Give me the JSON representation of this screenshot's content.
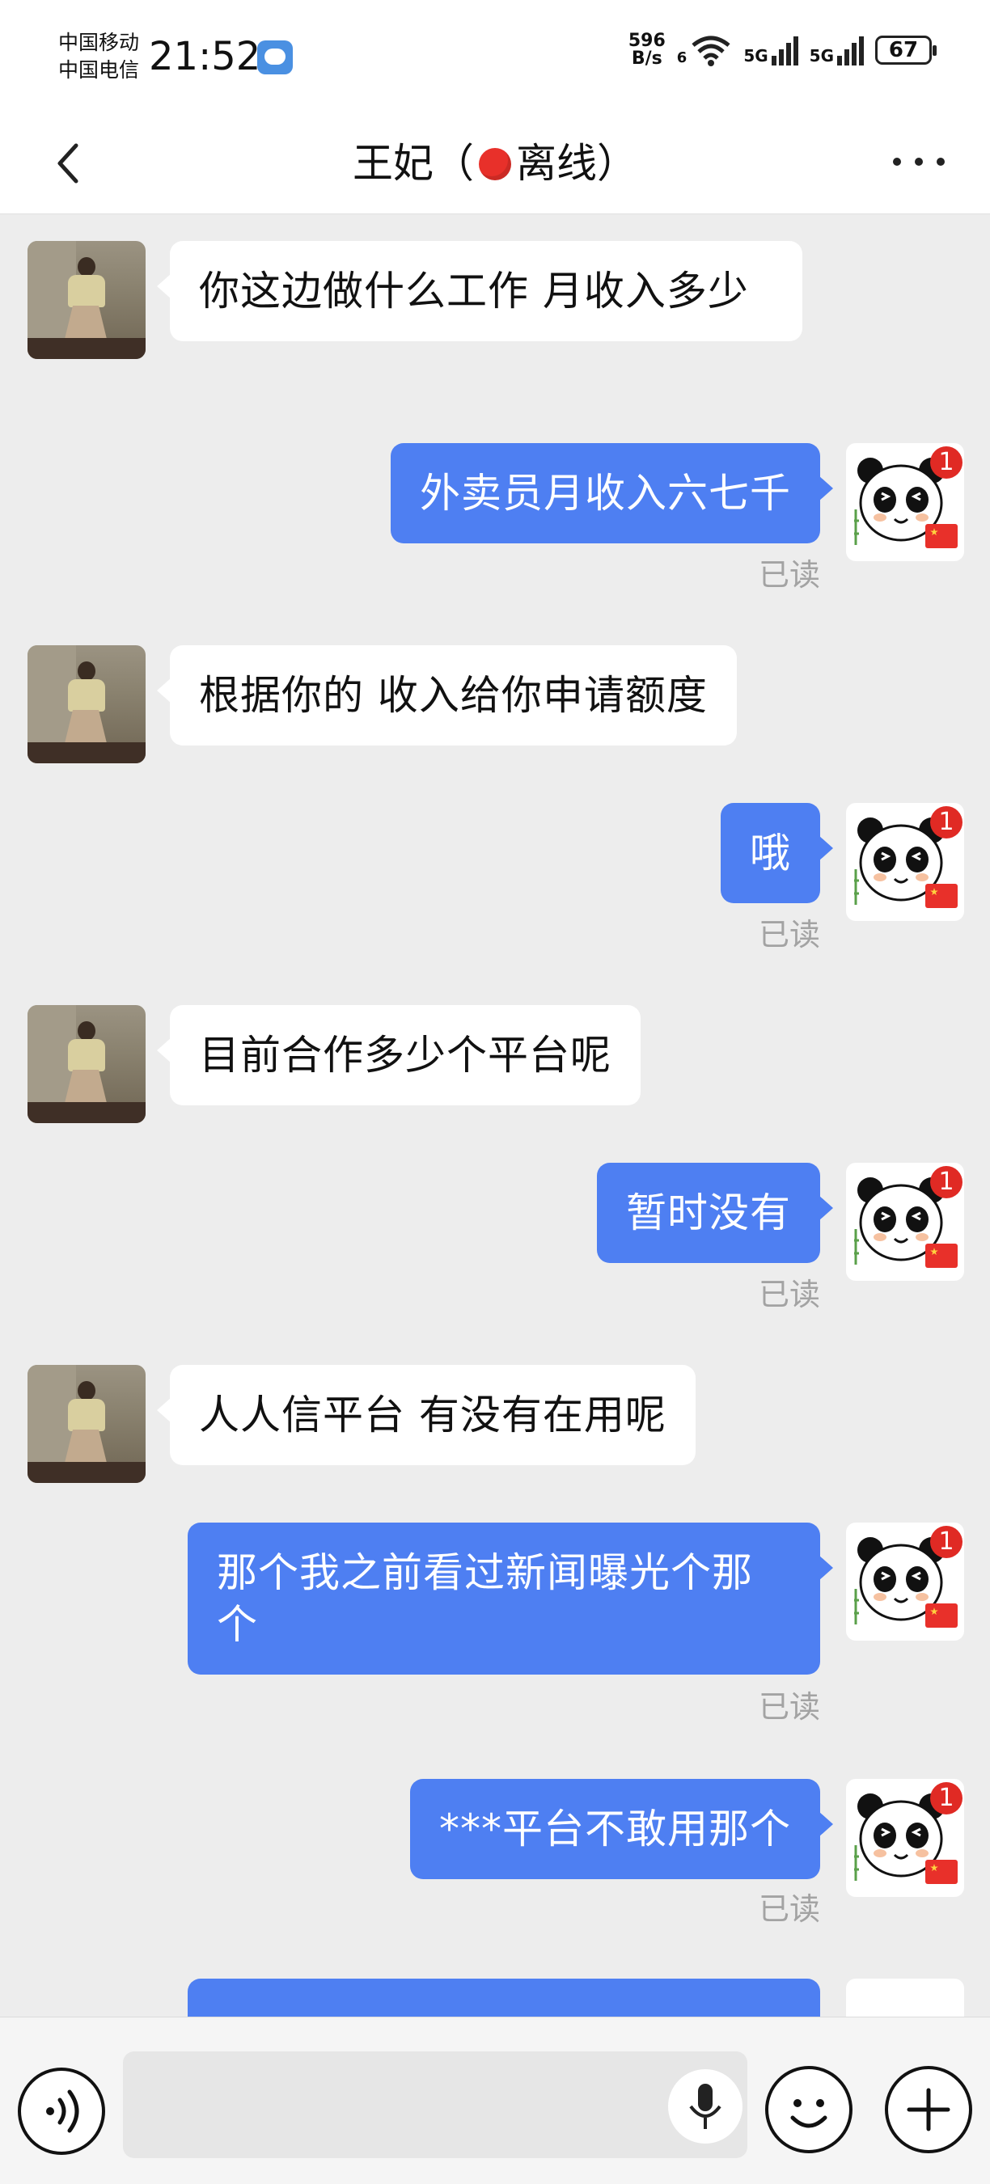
{
  "status_bar": {
    "carrier_1": "中国移动",
    "carrier_2": "中国电信",
    "time": "21:52",
    "net_speed_value": "596",
    "net_speed_unit": "B/s",
    "wifi_label": "6",
    "signal_1_label": "5G",
    "signal_2_label": "5G",
    "battery": "67"
  },
  "header": {
    "contact_name": "王妃（",
    "status_text": "离线）",
    "status_color": "#e8302a"
  },
  "messages": [
    {
      "side": "left",
      "text": "你这边做什么工作 月收入多少"
    },
    {
      "side": "right",
      "text": "外卖员月收入六七千",
      "status": "已读"
    },
    {
      "side": "left",
      "text": "根据你的 收入给你申请额度"
    },
    {
      "side": "right",
      "text": "哦",
      "status": "已读"
    },
    {
      "side": "left",
      "text": "目前合作多少个平台呢"
    },
    {
      "side": "right",
      "text": "暂时没有",
      "status": "已读"
    },
    {
      "side": "left",
      "text": "人人信平台 有没有在用呢"
    },
    {
      "side": "right",
      "text": "那个我之前看过新闻曝光个那个",
      "status": "已读"
    },
    {
      "side": "right",
      "text": "***平台不敢用那个",
      "status": "已读"
    }
  ],
  "avatar_badge": "1",
  "colors": {
    "accent": "#4e7ff2",
    "background": "#ededed",
    "badge": "#e02a24"
  },
  "input_bar": {
    "icons": [
      "voice-icon",
      "microphone-icon",
      "emoji-icon",
      "plus-icon"
    ]
  }
}
